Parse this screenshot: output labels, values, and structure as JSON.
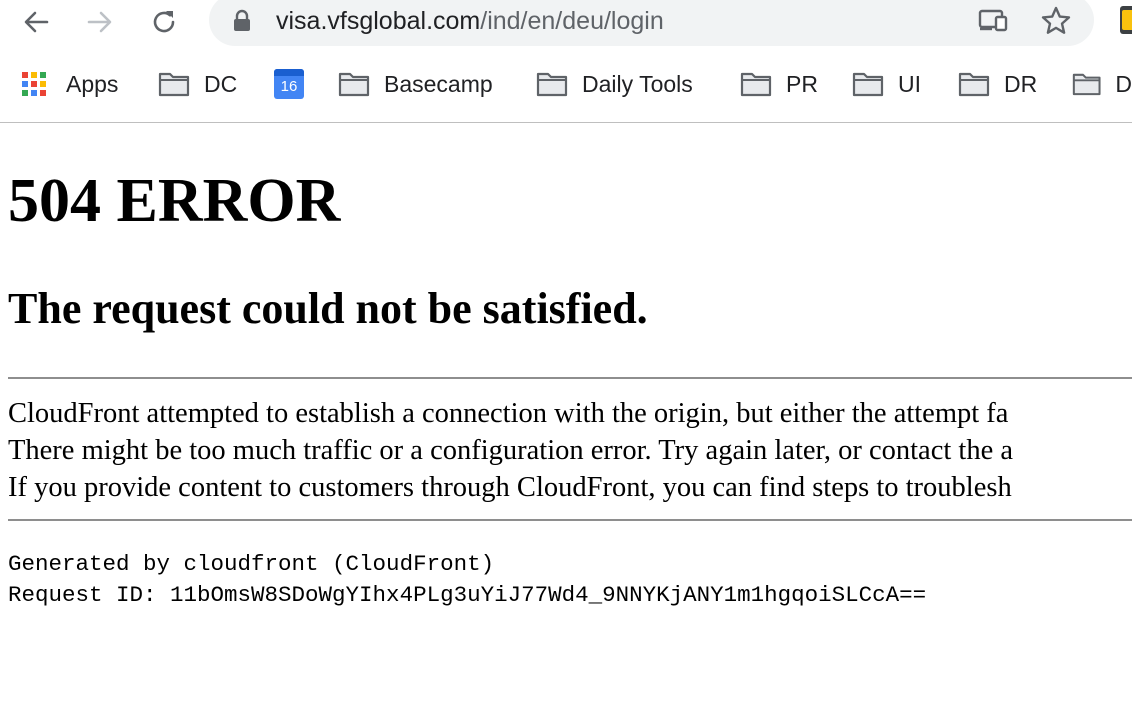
{
  "browser": {
    "url_host": "visa.vfsglobal.com",
    "url_path": "/ind/en/deu/login",
    "icons": {
      "back": "arrow-left-icon",
      "forward": "arrow-right-icon",
      "reload": "reload-icon",
      "lock": "lock-icon",
      "cast": "cast-icon",
      "bookmark": "star-icon"
    },
    "bookmarks": [
      {
        "label": "Apps",
        "icon": "apps-grid-icon"
      },
      {
        "label": "DC",
        "icon": "folder-icon"
      },
      {
        "label": "16",
        "icon": "calendar-icon"
      },
      {
        "label": "Basecamp",
        "icon": "folder-icon"
      },
      {
        "label": "Daily Tools",
        "icon": "folder-icon"
      },
      {
        "label": "PR",
        "icon": "folder-icon"
      },
      {
        "label": "UI",
        "icon": "folder-icon"
      },
      {
        "label": "DR",
        "icon": "folder-icon"
      },
      {
        "label": "D",
        "icon": "folder-icon"
      }
    ]
  },
  "page": {
    "title": "504 ERROR",
    "subtitle": "The request could not be satisfied.",
    "message_lines": [
      "CloudFront attempted to establish a connection with the origin, but either the attempt fa",
      "There might be too much traffic or a configuration error. Try again later, or contact the a",
      "If you provide content to customers through CloudFront, you can find steps to troublesh"
    ],
    "generated_by": "Generated by cloudfront (CloudFront)",
    "request_id": "Request ID: 11bOmsW8SDoWgYIhx4PLg3uYiJ77Wd4_9NNYKjANY1m1hgqoiSLCcA=="
  },
  "colors": {
    "toolbar_bg": "#ffffff",
    "omnibox_bg": "#f1f3f4",
    "icon_gray": "#5f6368",
    "calendar_blue": "#4285f4",
    "rule_gray": "#8e8e8e"
  }
}
